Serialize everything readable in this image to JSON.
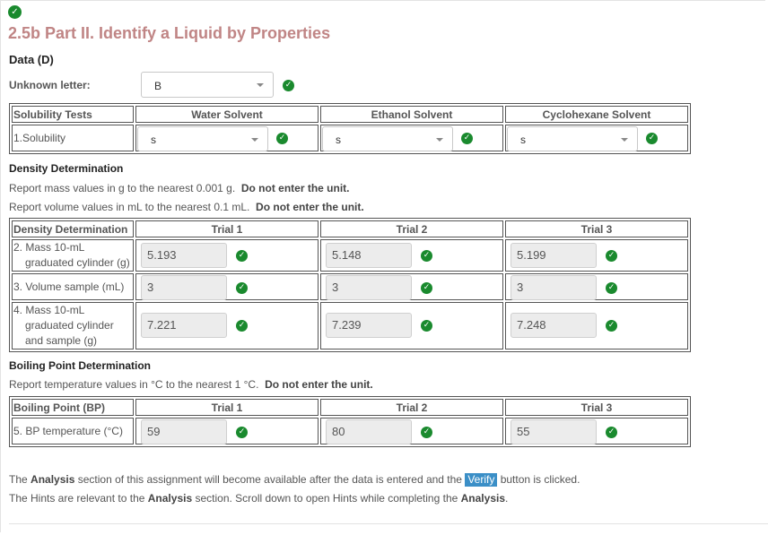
{
  "page": {
    "title": "2.5b Part II. Identify a Liquid by Properties",
    "data_heading": "Data (D)",
    "colors": {
      "title": "#c08585",
      "check": "#1a8a2e",
      "verify_bg": "#3b8fc7"
    }
  },
  "unknown": {
    "label": "Unknown letter:",
    "value": "B"
  },
  "solubility": {
    "headers": [
      "Solubility Tests",
      "Water Solvent",
      "Ethanol Solvent",
      "Cyclohexane Solvent"
    ],
    "row_label": "1.Solubility",
    "values": [
      "s",
      "s",
      "s"
    ]
  },
  "density": {
    "heading": "Density Determination",
    "note1_text": "Report mass values in g to the nearest 0.001 g.",
    "note1_bold": "Do not enter the unit.",
    "note2_text": "Report volume values in mL to the nearest 0.1 mL.",
    "note2_bold": "Do not enter the unit.",
    "headers": [
      "Density Determination",
      "Trial 1",
      "Trial 2",
      "Trial 3"
    ],
    "rows": [
      {
        "label_a": "2. Mass 10-mL",
        "label_b": "graduated cylinder (g)",
        "values": [
          "5.193",
          "5.148",
          "5.199"
        ]
      },
      {
        "label_a": "3. Volume sample (mL)",
        "values": [
          "3",
          "3",
          "3"
        ]
      },
      {
        "label_a": "4. Mass 10-mL",
        "label_b": "graduated cylinder",
        "label_c": "and sample (g)",
        "values": [
          "7.221",
          "7.239",
          "7.248"
        ]
      }
    ]
  },
  "boiling": {
    "heading": "Boiling Point Determination",
    "note_text": "Report temperature values in °C to the nearest 1 °C.",
    "note_bold": "Do not enter the unit.",
    "headers": [
      "Boiling Point (BP)",
      "Trial 1",
      "Trial 2",
      "Trial 3"
    ],
    "row_label": "5. BP temperature (°C)",
    "values": [
      "59",
      "80",
      "55"
    ]
  },
  "footer": {
    "line1_a": "The",
    "line1_b": "Analysis",
    "line1_c": "section of this assignment will become available after the data is entered and the",
    "verify": "Verify",
    "line1_d": "button is clicked.",
    "line2_a": "The Hints are relevant to the",
    "line2_b": "Analysis",
    "line2_c": "section.  Scroll down to open Hints while completing the",
    "line2_d": "Analysis",
    "line2_e": "."
  }
}
